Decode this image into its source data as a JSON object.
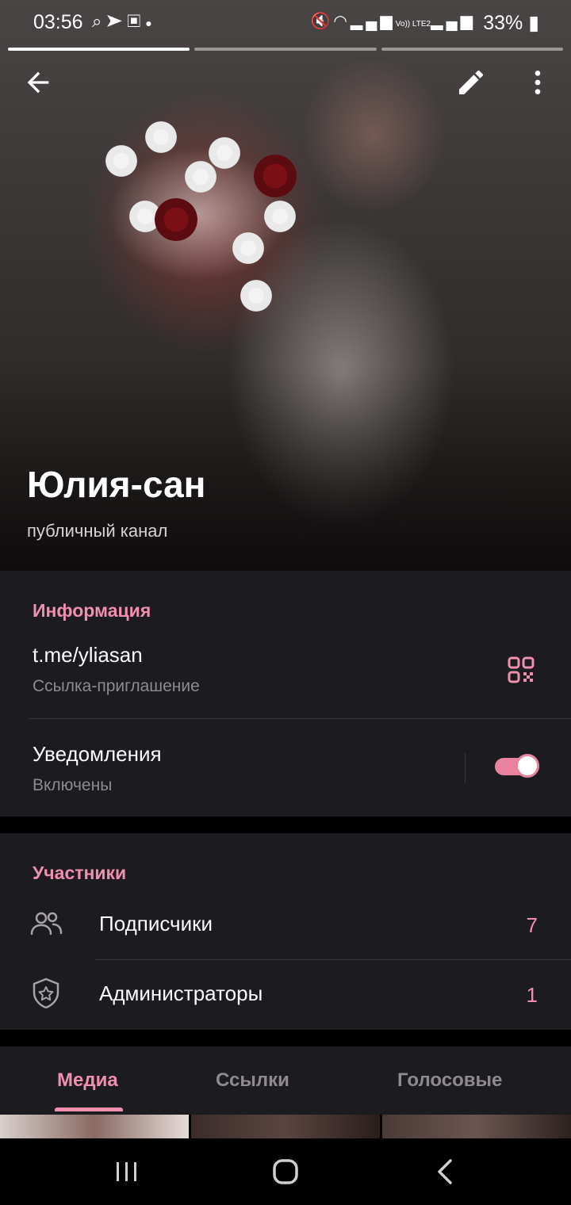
{
  "status_bar": {
    "time": "03:56",
    "left_icons": [
      "search-icon",
      "telegram-icon",
      "image-icon",
      "dot-icon"
    ],
    "right_icons": [
      "mute-icon",
      "wifi-icon",
      "signal-icon",
      "volte-icon",
      "signal-icon"
    ],
    "volte_text": "Vo)) LTE2",
    "battery": "33%"
  },
  "story_progress": {
    "segments": 3,
    "active_index": 0
  },
  "header": {
    "back_icon": "arrow-back-icon",
    "edit_icon": "pencil-icon",
    "more_icon": "more-vertical-icon",
    "channel_name": "Юлия-сан",
    "channel_type": "публичный канал"
  },
  "info": {
    "title": "Информация",
    "link": "t.me/yliasan",
    "link_caption": "Ссылка-приглашение",
    "qr_icon": "qr-code-icon",
    "notifications_label": "Уведомления",
    "notifications_state": "Включены",
    "notifications_enabled": true
  },
  "members": {
    "title": "Участники",
    "items": [
      {
        "icon": "users-icon",
        "label": "Подписчики",
        "count": "7"
      },
      {
        "icon": "shield-star-icon",
        "label": "Администраторы",
        "count": "1"
      }
    ]
  },
  "tabs": {
    "items": [
      "Медиа",
      "Ссылки",
      "Голосовые"
    ],
    "active_index": 0
  },
  "colors": {
    "accent": "#f08fae",
    "section_bg": "#1c1b1f",
    "secondary_text": "#8e8a8f"
  },
  "nav": {
    "recents_icon": "recents-icon",
    "home_icon": "home-icon",
    "back_icon": "nav-back-icon"
  }
}
